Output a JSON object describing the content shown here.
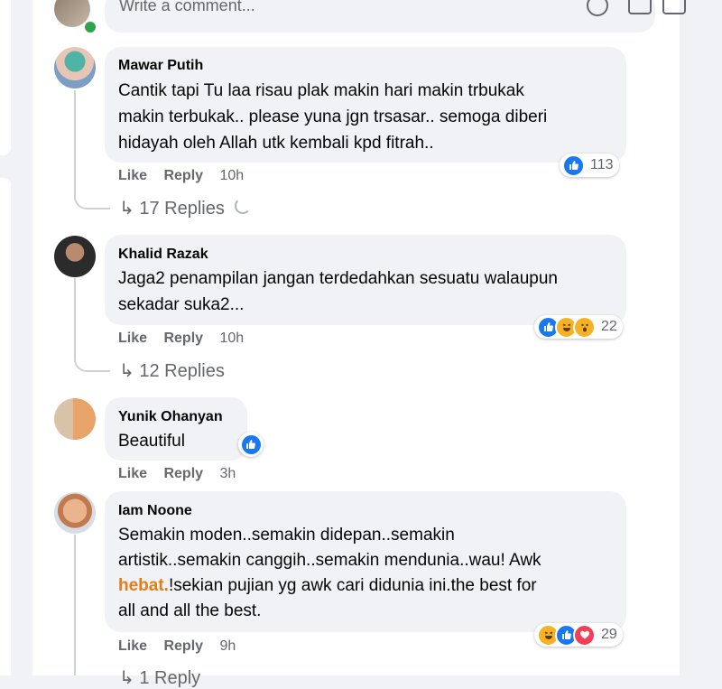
{
  "write_comment": {
    "placeholder": "Write a comment..."
  },
  "comments": [
    {
      "author": "Mawar Putih",
      "lines": [
        "Cantik tapi Tu laa risau plak makin hari makin trbukak",
        "makin terbukak.. please yuna jgn trsasar.. semoga diberi",
        "hidayah oleh Allah utk kembali kpd fitrah.."
      ],
      "like": "Like",
      "reply": "Reply",
      "time": "10h",
      "reaction_count": "113",
      "replies": "17 Replies"
    },
    {
      "author": "Khalid Razak",
      "lines": [
        "Jaga2 penampilan jangan terdedahkan sesuatu walaupun",
        "sekadar suka2..."
      ],
      "like": "Like",
      "reply": "Reply",
      "time": "10h",
      "reaction_count": "22",
      "replies": "12 Replies"
    },
    {
      "author": "Yunik Ohanyan",
      "lines": [
        "Beautiful"
      ],
      "like": "Like",
      "reply": "Reply",
      "time": "3h"
    },
    {
      "author": "Iam Noone",
      "lines": [
        "Semakin moden..semakin didepan..semakin",
        "artistik..semakin canggih..semakin mendunia..wau! Awk"
      ],
      "line3_highlight": "hebat.",
      "line3_rest": "!sekian pujian yg awk cari didunia ini.the best for",
      "line4": "all and all the best.",
      "like": "Like",
      "reply": "Reply",
      "time": "9h",
      "reaction_count": "29",
      "replies": "1 Reply"
    }
  ],
  "colors": {
    "like": "#1877f2",
    "link_highlight": "#e07e1a",
    "bubble": "#f0f2f5",
    "meta": "#65676b"
  }
}
